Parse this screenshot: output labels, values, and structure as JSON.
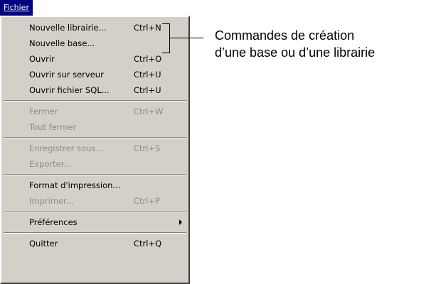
{
  "menu": {
    "title": "Fichier",
    "items": [
      {
        "label": "Nouvelle librairie...",
        "shortcut": "Ctrl+N",
        "enabled": true
      },
      {
        "label": "Nouvelle base...",
        "shortcut": "",
        "enabled": true
      },
      {
        "label": "Ouvrir",
        "shortcut": "Ctrl+O",
        "enabled": true
      },
      {
        "label": "Ouvrir sur serveur",
        "shortcut": "Ctrl+U",
        "enabled": true
      },
      {
        "label": "Ouvrir fichier SQL...",
        "shortcut": "Ctrl+U",
        "enabled": true
      },
      {
        "label": "Fermer",
        "shortcut": "Ctrl+W",
        "enabled": false
      },
      {
        "label": "Tout fermer",
        "shortcut": "",
        "enabled": false
      },
      {
        "label": "Enregistrer sous...",
        "shortcut": "Ctrl+S",
        "enabled": false
      },
      {
        "label": "Exporter...",
        "shortcut": "",
        "enabled": false
      },
      {
        "label": "Format d'impression...",
        "shortcut": "",
        "enabled": true
      },
      {
        "label": "Imprimer...",
        "shortcut": "Ctrl+P",
        "enabled": false
      },
      {
        "label": "Préférences",
        "shortcut": "",
        "enabled": true,
        "submenu": true
      },
      {
        "label": "Quitter",
        "shortcut": "Ctrl+Q",
        "enabled": true
      }
    ]
  },
  "annotation": {
    "line1": "Commandes de création",
    "line2": "d’une base ou d’une librairie"
  },
  "colors": {
    "menu_background": "#d4d0c8",
    "title_highlight": "#000080",
    "disabled_text": "#8c8c8c"
  }
}
